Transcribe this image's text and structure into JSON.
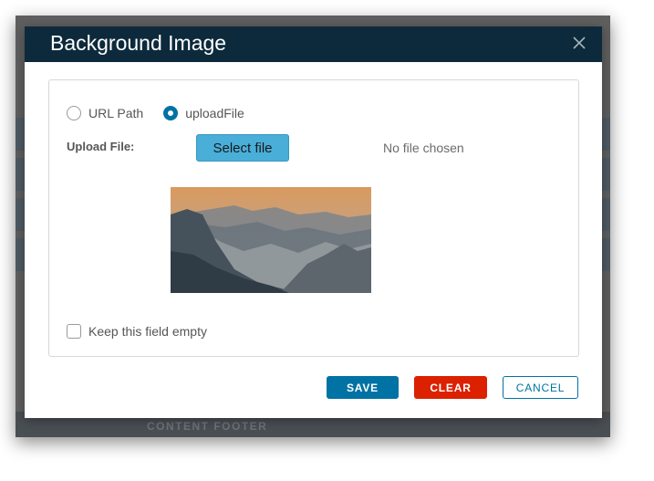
{
  "backdrop": {
    "footer_label": "CONTENT FOOTER"
  },
  "modal": {
    "title": "Background Image",
    "close_icon": "close-icon"
  },
  "source": {
    "options": [
      {
        "label": "URL Path",
        "selected": false
      },
      {
        "label": "uploadFile",
        "selected": true
      }
    ]
  },
  "upload": {
    "label": "Upload File:",
    "button_label": "Select file",
    "status": "No file chosen"
  },
  "keep_empty": {
    "label": "Keep this field empty",
    "checked": false
  },
  "actions": {
    "save": "SAVE",
    "clear": "CLEAR",
    "cancel": "CANCEL"
  },
  "colors": {
    "header": "#0d2a3c",
    "primary": "#0072a3",
    "danger": "#db2100",
    "select_file": "#49afd9"
  }
}
